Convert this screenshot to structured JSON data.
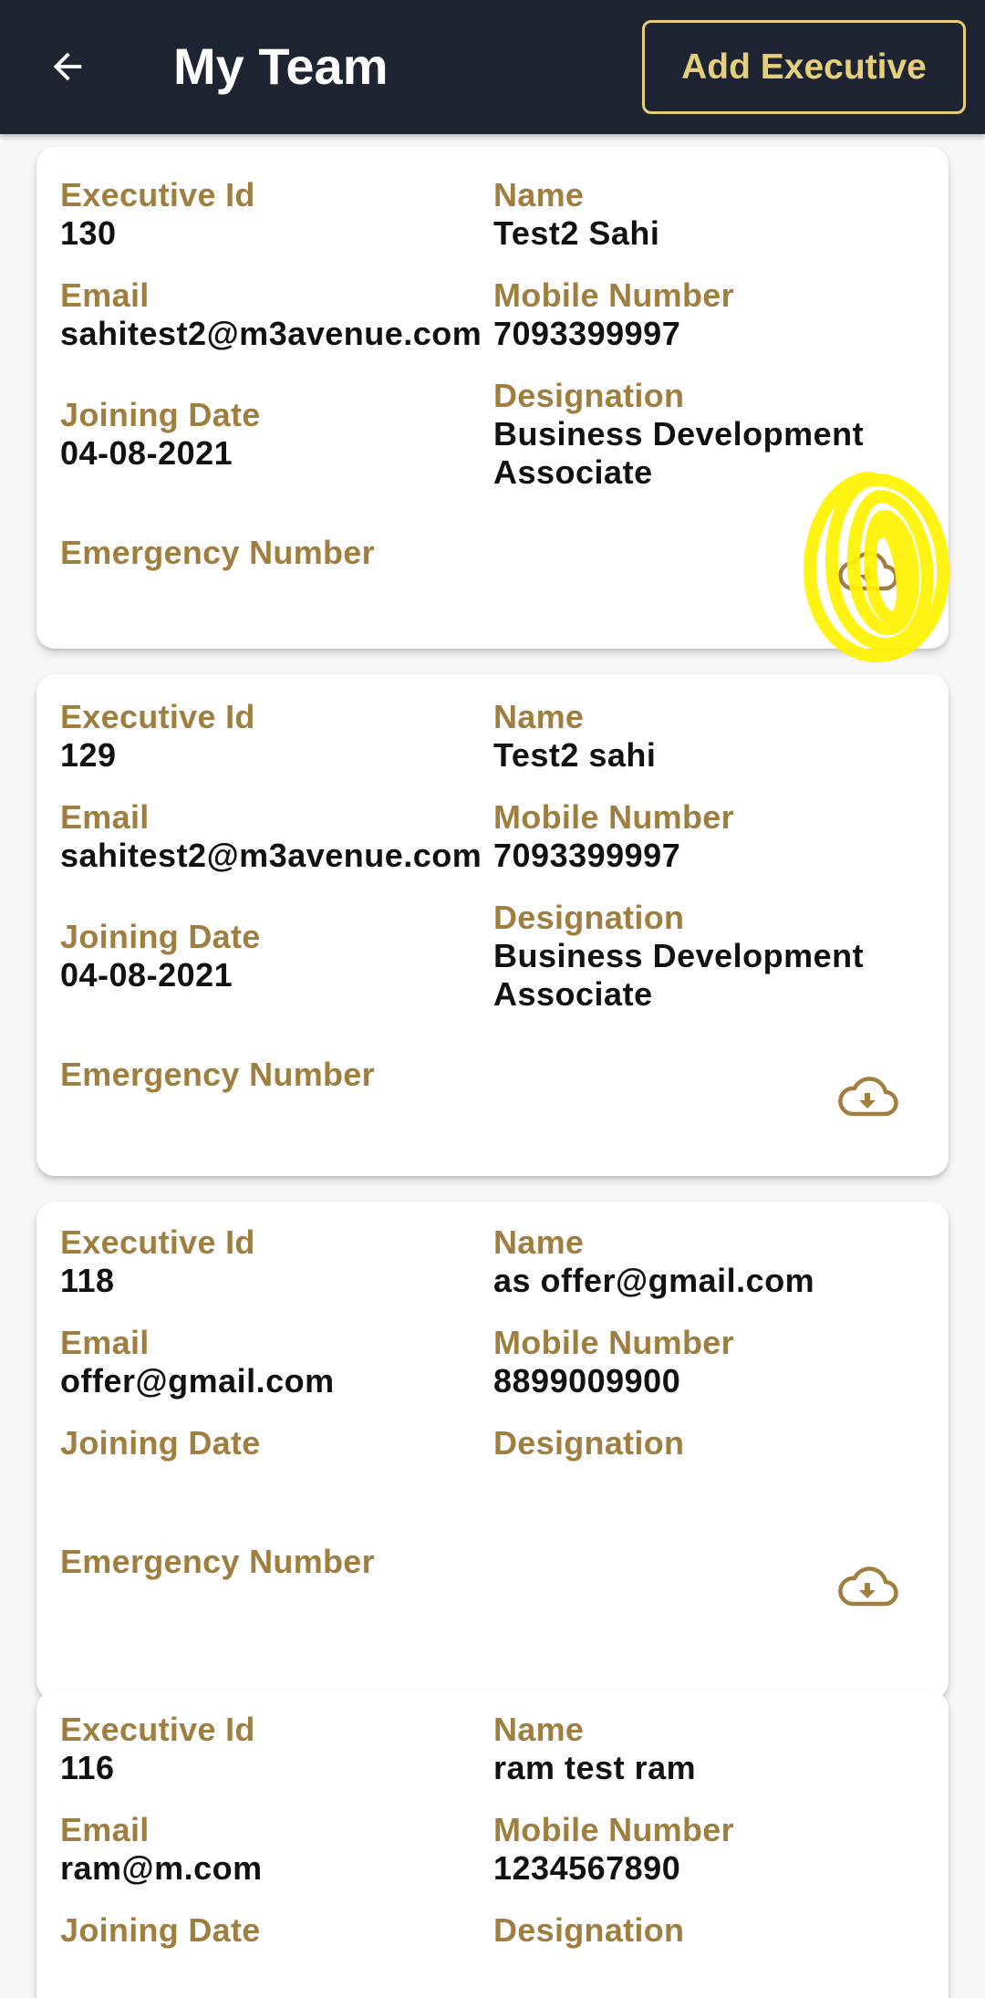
{
  "header": {
    "title": "My Team",
    "add_button_label": "Add Executive",
    "back_icon": "arrow-left-icon"
  },
  "labels": {
    "executive_id": "Executive Id",
    "name": "Name",
    "email": "Email",
    "mobile": "Mobile Number",
    "joining_date": "Joining Date",
    "designation": "Designation",
    "emergency": "Emergency Number"
  },
  "download_icon": "cloud-download-icon",
  "colors": {
    "appbar": "#1f2433",
    "accent": "#e6cf7b",
    "label": "#a07e3f",
    "highlight": "#fff200"
  },
  "executives": [
    {
      "id": "130",
      "name": "Test2 Sahi",
      "email": "sahitest2@m3avenue.com",
      "mobile": "7093399997",
      "joining_date": "04-08-2021",
      "designation": "Business Development\nAssociate",
      "emergency": ""
    },
    {
      "id": "129",
      "name": "Test2 sahi",
      "email": "sahitest2@m3avenue.com",
      "mobile": "7093399997",
      "joining_date": "04-08-2021",
      "designation": "Business Development\nAssociate",
      "emergency": ""
    },
    {
      "id": "118",
      "name": "as offer@gmail.com",
      "email": "offer@gmail.com",
      "mobile": "8899009900",
      "joining_date": "",
      "designation": "",
      "emergency": ""
    },
    {
      "id": "116",
      "name": "ram test ram",
      "email": "ram@m.com",
      "mobile": "1234567890",
      "joining_date": "",
      "designation": "",
      "emergency": ""
    }
  ]
}
